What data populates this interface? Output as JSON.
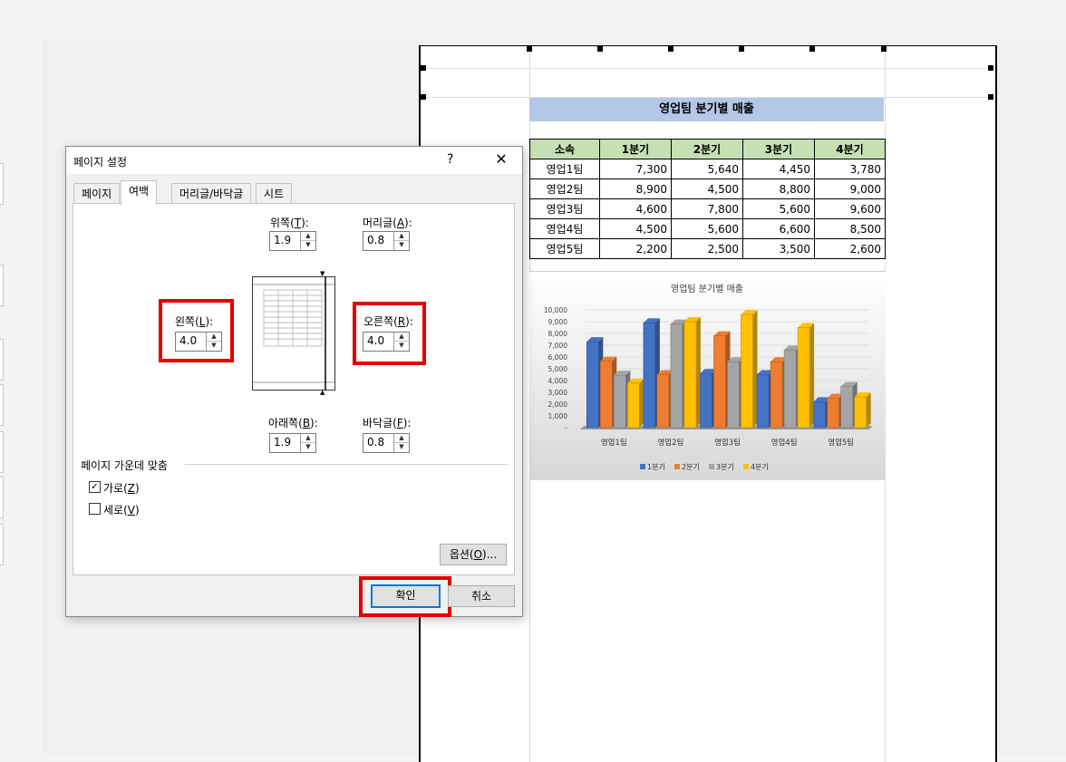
{
  "sheet": {
    "title": "영업팀 분기별 매출",
    "headers": [
      "소속",
      "1분기",
      "2분기",
      "3분기",
      "4분기"
    ],
    "rows": [
      [
        "영업1팀",
        "7,300",
        "5,640",
        "4,450",
        "3,780"
      ],
      [
        "영업2팀",
        "8,900",
        "4,500",
        "8,800",
        "9,000"
      ],
      [
        "영업3팀",
        "4,600",
        "7,800",
        "5,600",
        "9,600"
      ],
      [
        "영업4팀",
        "4,500",
        "5,600",
        "6,600",
        "8,500"
      ],
      [
        "영업5팀",
        "2,200",
        "2,500",
        "3,500",
        "2,600"
      ]
    ]
  },
  "chart_data": {
    "type": "bar",
    "title": "영업팀 분기별 매출",
    "categories": [
      "영업1팀",
      "영업2팀",
      "영업3팀",
      "영업4팀",
      "영업5팀"
    ],
    "series": [
      {
        "name": "1분기",
        "values": [
          7300,
          8900,
          4600,
          4500,
          2200
        ],
        "color": "#4472c4"
      },
      {
        "name": "2분기",
        "values": [
          5640,
          4500,
          7800,
          5600,
          2500
        ],
        "color": "#ed7d31"
      },
      {
        "name": "3분기",
        "values": [
          4450,
          8800,
          5600,
          6600,
          3500
        ],
        "color": "#a5a5a5"
      },
      {
        "name": "4분기",
        "values": [
          3780,
          9000,
          9600,
          8500,
          2600
        ],
        "color": "#ffc000"
      }
    ],
    "ylim": [
      0,
      10000
    ],
    "yticks": [
      "-",
      "1,000",
      "2,000",
      "3,000",
      "4,000",
      "5,000",
      "6,000",
      "7,000",
      "8,000",
      "9,000",
      "10,000"
    ],
    "grid": true,
    "legend": "bottom"
  },
  "dialog": {
    "title": "페이지 설정",
    "help": "?",
    "close": "✕",
    "tabs": [
      "페이지",
      "여백",
      "머리글/바닥글",
      "시트"
    ],
    "active_tab": "여백",
    "top": {
      "label": "위쪽(",
      "key": "T",
      "tail": "):",
      "value": "1.9"
    },
    "header": {
      "label": "머리글(",
      "key": "A",
      "tail": "):",
      "value": "0.8"
    },
    "left": {
      "label": "왼쪽(",
      "key": "L",
      "tail": "):",
      "value": "4.0"
    },
    "right": {
      "label": "오른쪽(",
      "key": "R",
      "tail": "):",
      "value": "4.0"
    },
    "bottom": {
      "label": "아래쪽(",
      "key": "B",
      "tail": "):",
      "value": "1.9"
    },
    "footer": {
      "label": "바닥글(",
      "key": "F",
      "tail": "):",
      "value": "0.8"
    },
    "center_section": "페이지 가운데 맞춤",
    "horizontal": {
      "label": "가로(",
      "key": "Z",
      "tail": ")",
      "checked": true
    },
    "vertical": {
      "label": "세로(",
      "key": "V",
      "tail": ")",
      "checked": false
    },
    "options_btn": {
      "label": "옵션(",
      "key": "O",
      "tail": ")..."
    },
    "ok": "확인",
    "cancel": "취소"
  },
  "colors": {
    "highlight": "#e30000",
    "title_fill": "#b4c7e7",
    "header_fill": "#c6e0b4"
  }
}
